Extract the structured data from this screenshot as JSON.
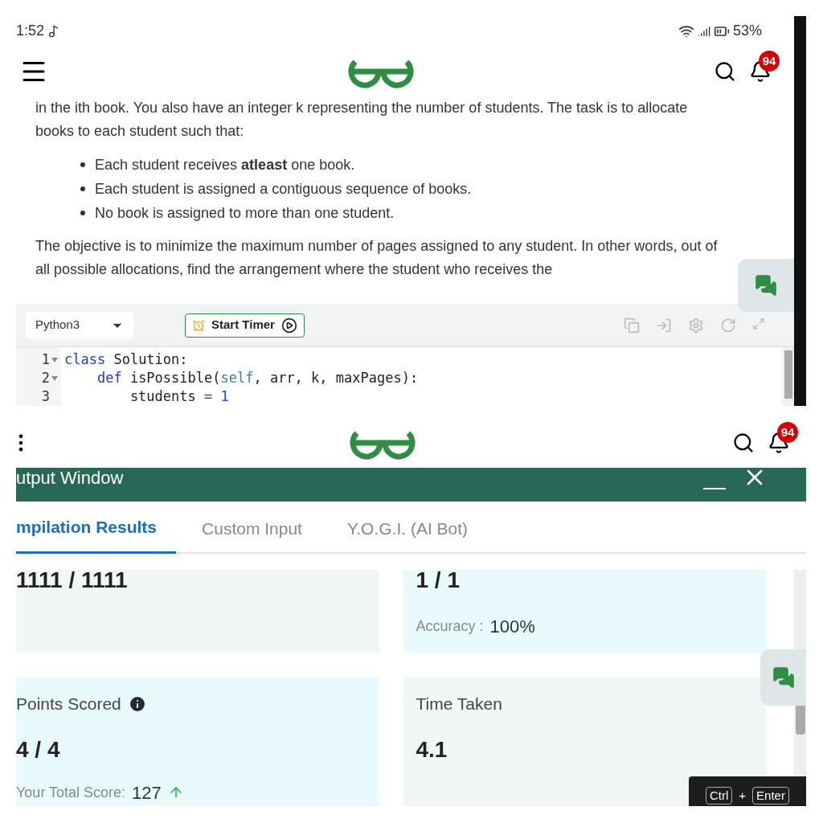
{
  "top_screen": {
    "status_bar": {
      "time": "1:52",
      "battery": "53%"
    },
    "header": {
      "notification_count": "94"
    },
    "problem": {
      "intro": "in the ith book. You also have an integer k representing the number of students. The task is to allocate books to each student such that:",
      "bullets": [
        "Each student receives **atleast** one book.",
        "Each student is assigned a contiguous sequence of books.",
        "No book is assigned to more than one student."
      ],
      "objective": "The objective is to minimize the maximum number of pages assigned to any student. In other words, out of all possible allocations, find the arrangement where the student who receives the"
    },
    "editor": {
      "language": "Python3",
      "timer_button": "Start Timer",
      "lines": [
        {
          "number": "1",
          "foldable": true,
          "tokens": [
            {
              "text": "class",
              "kind": "keyword"
            },
            {
              "text": " Solution:",
              "kind": "plain"
            }
          ]
        },
        {
          "number": "2",
          "foldable": true,
          "tokens": [
            {
              "text": "    def",
              "kind": "keyword"
            },
            {
              "text": " isPossible(",
              "kind": "plain"
            },
            {
              "text": "self",
              "kind": "builtin"
            },
            {
              "text": ", arr, k, maxPages):",
              "kind": "plain"
            }
          ]
        },
        {
          "number": "3",
          "foldable": false,
          "tokens": [
            {
              "text": "        students ",
              "kind": "plain"
            },
            {
              "text": "= ",
              "kind": "operator"
            },
            {
              "text": "1",
              "kind": "number"
            }
          ]
        }
      ]
    }
  },
  "bottom_screen": {
    "header": {
      "notification_count": "94"
    },
    "output_window": {
      "title": "utput Window",
      "tabs": [
        {
          "label": "mpilation Results",
          "selected": true
        },
        {
          "label": "Custom Input",
          "selected": false
        },
        {
          "label": "Y.O.G.I. (AI Bot)",
          "selected": false
        }
      ],
      "cards": [
        {
          "color": "#f1f7f5",
          "value": "1111 / 1111"
        },
        {
          "color": "#e9fafd",
          "value": "1 / 1",
          "caption": "Accuracy :",
          "caption_value": "100%"
        },
        {
          "color": "#e9fafd",
          "label": "Points Scored",
          "info": true,
          "value": "4 / 4",
          "caption": "Your Total Score:",
          "caption_value": "127",
          "trend_up": true
        },
        {
          "color": "#f1f7f5",
          "label": "Time Taken",
          "value": "4.1"
        }
      ],
      "shortcut": {
        "keys": [
          "Ctrl",
          "Enter"
        ],
        "joiner": "+"
      }
    }
  }
}
